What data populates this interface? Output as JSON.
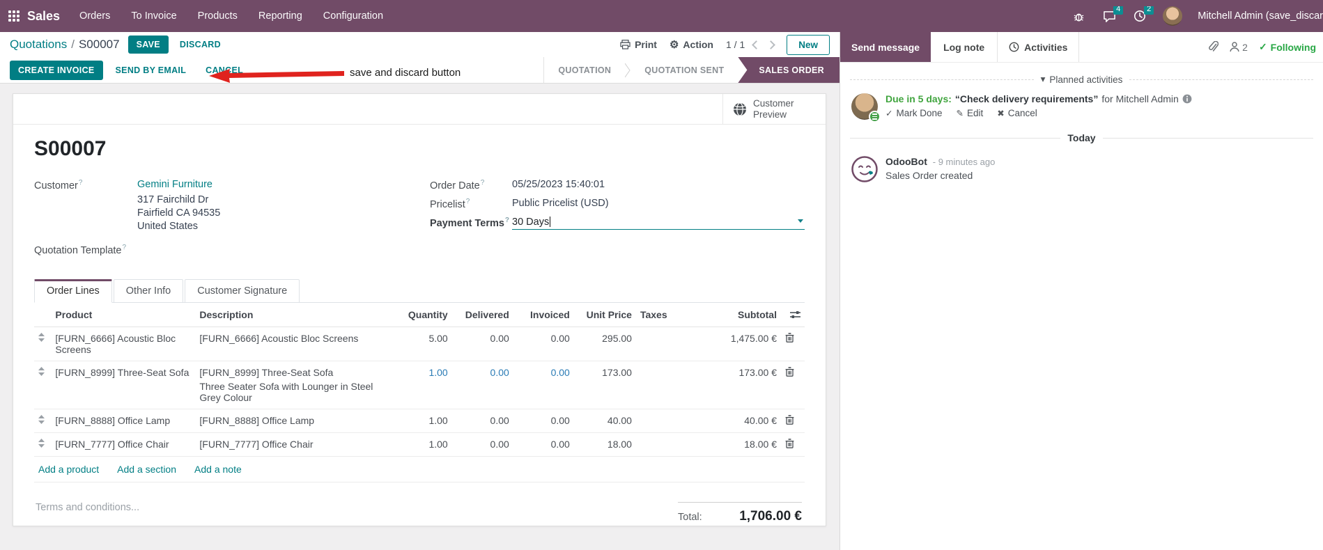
{
  "navbar": {
    "app": "Sales",
    "items": [
      {
        "label": "Orders"
      },
      {
        "label": "To Invoice"
      },
      {
        "label": "Products"
      },
      {
        "label": "Reporting"
      },
      {
        "label": "Configuration"
      }
    ],
    "messages_badge": "4",
    "activities_badge": "2",
    "user": "Mitchell Admin (save_discar"
  },
  "breadcrumb": {
    "parent": "Quotations",
    "separator": "/",
    "current": "S00007",
    "save": "SAVE",
    "discard": "DISCARD"
  },
  "annotation": {
    "text": "save and discard button"
  },
  "control_panel": {
    "print": "Print",
    "action": "Action",
    "pager": "1 / 1",
    "new": "New"
  },
  "statusbar": {
    "create_invoice": "CREATE INVOICE",
    "send_by_email": "SEND BY EMAIL",
    "cancel": "CANCEL",
    "states": [
      {
        "label": "QUOTATION"
      },
      {
        "label": "QUOTATION SENT"
      },
      {
        "label": "SALES ORDER"
      }
    ],
    "active_state": "SALES ORDER"
  },
  "form": {
    "preview_button": "Customer Preview",
    "title": "S00007",
    "customer_label": "Customer",
    "customer_name": "Gemini Furniture",
    "address_line1": "317 Fairchild Dr",
    "address_line2": "Fairfield CA 94535",
    "address_line3": "United States",
    "quotation_template_label": "Quotation Template",
    "order_date_label": "Order Date",
    "order_date": "05/25/2023 15:40:01",
    "pricelist_label": "Pricelist",
    "pricelist": "Public Pricelist (USD)",
    "payment_terms_label": "Payment Terms",
    "payment_terms": "30 Days"
  },
  "tabs": [
    {
      "label": "Order Lines"
    },
    {
      "label": "Other Info"
    },
    {
      "label": "Customer Signature"
    }
  ],
  "orderlines": {
    "columns": {
      "product": "Product",
      "description": "Description",
      "quantity": "Quantity",
      "delivered": "Delivered",
      "invoiced": "Invoiced",
      "unit_price": "Unit Price",
      "taxes": "Taxes",
      "subtotal": "Subtotal"
    },
    "rows": [
      {
        "product": "[FURN_6666] Acoustic Bloc Screens",
        "description": "[FURN_6666] Acoustic Bloc Screens",
        "description2": "",
        "quantity": "5.00",
        "delivered": "0.00",
        "invoiced": "0.00",
        "unit_price": "295.00",
        "taxes": "",
        "subtotal": "1,475.00 €"
      },
      {
        "product": "[FURN_8999] Three-Seat Sofa",
        "description": "[FURN_8999] Three-Seat Sofa",
        "description2": "Three Seater Sofa with Lounger in Steel Grey Colour",
        "quantity": "1.00",
        "delivered": "0.00",
        "invoiced": "0.00",
        "unit_price": "173.00",
        "taxes": "",
        "subtotal": "173.00 €"
      },
      {
        "product": "[FURN_8888] Office Lamp",
        "description": "[FURN_8888] Office Lamp",
        "description2": "",
        "quantity": "1.00",
        "delivered": "0.00",
        "invoiced": "0.00",
        "unit_price": "40.00",
        "taxes": "",
        "subtotal": "40.00 €"
      },
      {
        "product": "[FURN_7777] Office Chair",
        "description": "[FURN_7777] Office Chair",
        "description2": "",
        "quantity": "1.00",
        "delivered": "0.00",
        "invoiced": "0.00",
        "unit_price": "18.00",
        "taxes": "",
        "subtotal": "18.00 €"
      }
    ],
    "add_product": "Add a product",
    "add_section": "Add a section",
    "add_note": "Add a note",
    "terms_placeholder": "Terms and conditions...",
    "total_label": "Total:",
    "total_value": "1,706.00 €"
  },
  "chatter": {
    "send_message": "Send message",
    "log_note": "Log note",
    "activities": "Activities",
    "followers_count": "2",
    "following": "Following",
    "planned_header": "Planned activities",
    "activity": {
      "due": "Due in 5 days:",
      "title": "“Check delivery requirements”",
      "assignee": "for Mitchell Admin",
      "mark_done": "Mark Done",
      "edit": "Edit",
      "cancel": "Cancel"
    },
    "today": "Today",
    "message": {
      "author": "OdooBot",
      "time": "- 9 minutes ago",
      "body": "Sales Order created"
    }
  },
  "colors": {
    "brand_purple": "#714B67",
    "accent_teal": "#017e84",
    "edited_blue": "#2a7bb5",
    "success_green": "#28a745",
    "annotation_red": "#e0231e"
  }
}
